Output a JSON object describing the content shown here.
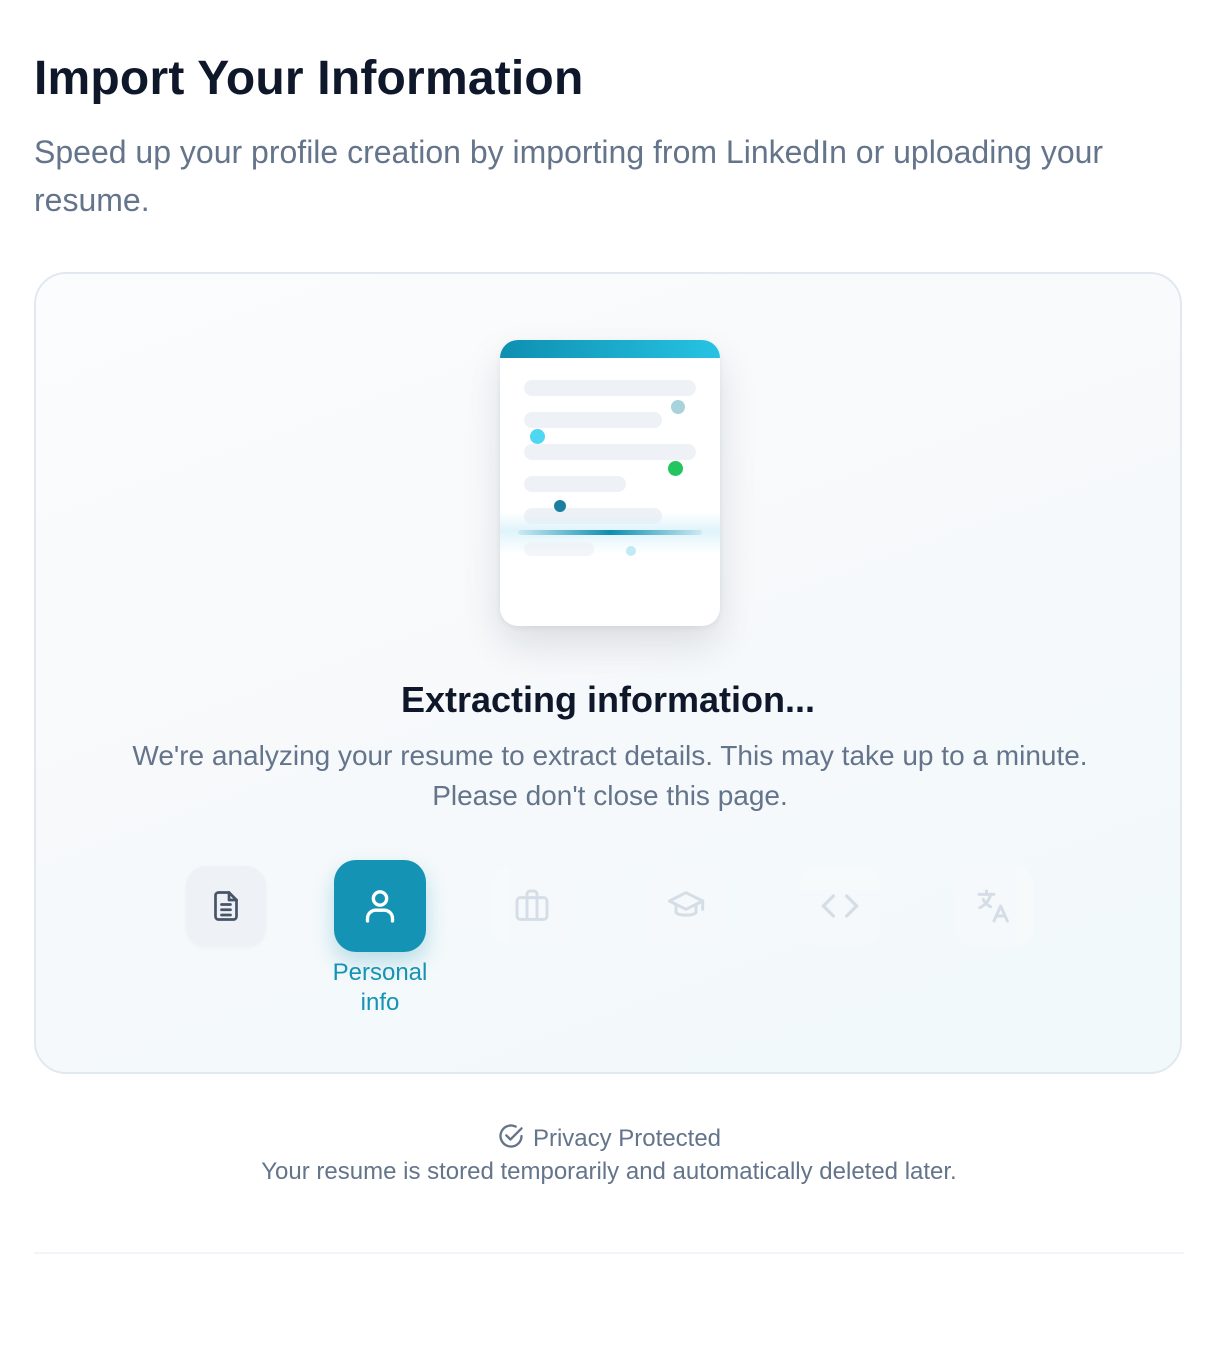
{
  "header": {
    "title": "Import Your Information",
    "subtitle": "Speed up your profile creation by importing from LinkedIn or uploading your resume."
  },
  "status": {
    "title": "Extracting information...",
    "description": "We're analyzing your resume to extract details. This may take up to a minute. Please don't close this page."
  },
  "steps": [
    {
      "icon": "document-icon",
      "state": "done"
    },
    {
      "icon": "user-icon",
      "state": "active",
      "label": "Personal info"
    },
    {
      "icon": "briefcase-icon",
      "state": "pending"
    },
    {
      "icon": "graduation-cap-icon",
      "state": "pending"
    },
    {
      "icon": "code-icon",
      "state": "pending"
    },
    {
      "icon": "translate-icon",
      "state": "pending"
    }
  ],
  "privacy": {
    "icon": "check-circle-icon",
    "title": "Privacy Protected",
    "description": "Your resume is stored temporarily and automatically deleted later."
  },
  "colors": {
    "accent": "#1593b4",
    "title": "#0f172a",
    "muted": "#64748b",
    "border": "#e2e8f0",
    "green_dot": "#22c55e",
    "cyan_dot": "#4fd6f2"
  }
}
